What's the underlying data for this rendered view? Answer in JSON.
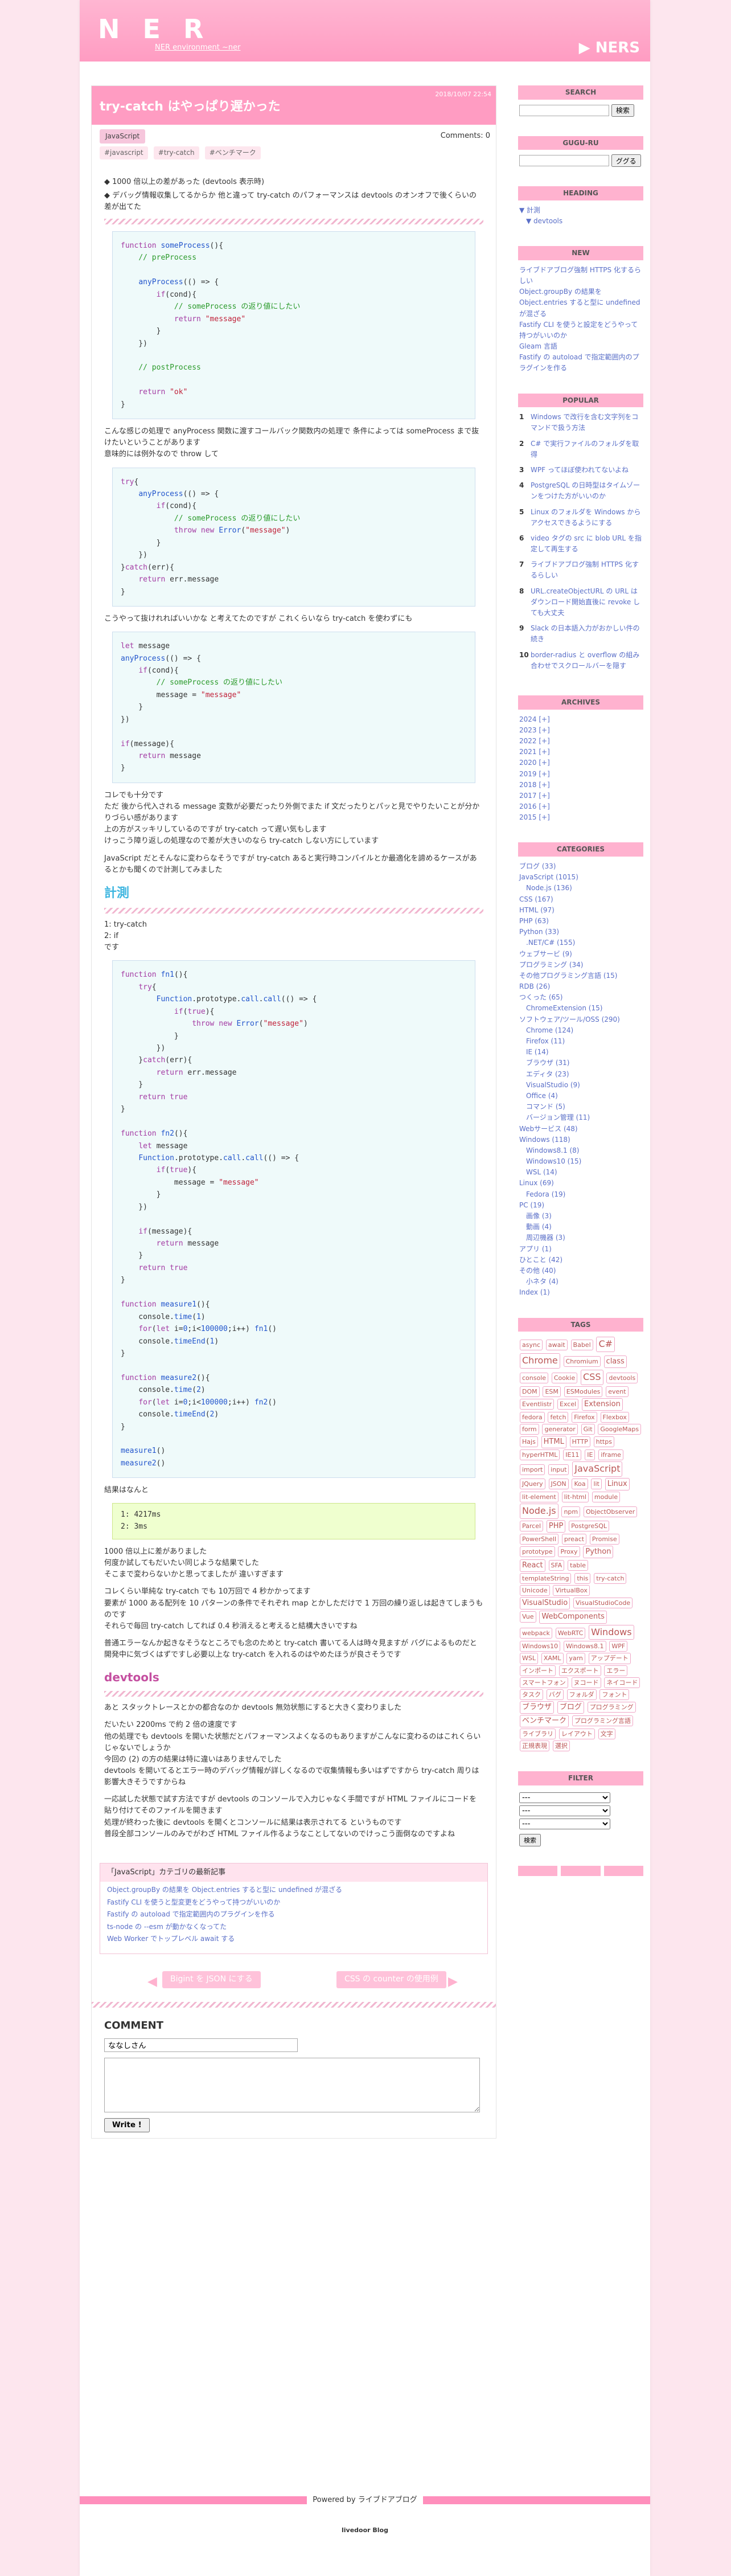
{
  "site": {
    "logo": "N E R",
    "subtitle": "NER environment   ~ner",
    "right": "▶ NERS"
  },
  "article": {
    "title": "try-catch はやっぱり遅かった",
    "date": "2018/10/07 22:54",
    "category": "JavaScript",
    "comments": "Comments: 0",
    "tags": [
      "#javascript",
      "#try-catch",
      "#ベンチマーク"
    ],
    "intro": [
      "◆ 1000 倍以上の差があった (devtools 表示時)",
      "◆ デバッグ情報収集してるからか 他と違って try-catch のパフォーマンスは devtools のオンオフで後くらいの差が出てた"
    ],
    "p1": "こんな感じの処理で anyProcess 関数に渡すコールバック関数内の処理で 条件によっては someProcess まで抜けたいということがあります\n意味的には例外なので throw して",
    "p2": "こうやって抜けれればいいかな と考えてたのですが これくらいなら try-catch を使わずにも",
    "p3": "コレでも十分です\nただ 後から代入される message 変数が必要だったり外側でまた if 文だったりとパッと見でやりたいことが分かりづらい感があります\n上の方がスッキリしているのですが try-catch って遅い気もします\nけっこう障り返しの処理なので差が大きいのなら try-catch しない方にしています",
    "p4": "JavaScript だとそんなに変わらなそうですが try-catch あると実行時コンパイルとか最適化を諦めるケースがあるとかも聞くので計測してみました",
    "measure_title": "計測",
    "measure_list": "1: try-catch\n2: if\nです",
    "result_label": "結果はなんと",
    "result": "1: 4217ms\n2: 3ms",
    "p5": "1000 倍以上に差がありました\n何度か試してもだいたい同じような結果でした\nそこまで変わらないかと思ってましたが 違いすぎます",
    "p6": "コレくらい単純な try-catch でも 10万回で 4 秒かかってます\n要素が 1000 ある配列を 10 パターンの条件でそれぞれ map とかしただけで 1 万回の繰り返しは起きてしまうものです\nそれらで毎回 try-catch してれば 0.4 秒消えると考えると結構大きいですね",
    "p7": "普通エラーなんか起きなそうなところでも念のためと try-catch 書いてる人は時々見ますが バグによるものだと開発中に気づくはずですし必要以上な try-catch を入れるのはやめたほうが良さそうです",
    "devtools_title": "devtools",
    "p8": "あと スタックトレースとかの都合なのか devtools 無効状態にすると大きく変わりました",
    "p9": "だいたい 2200ms で約 2 倍の速度です\n他の処理でも devtools を開いた状態だとパフォーマンスよくなるのもありますがこんなに変わるのはこれくらいじゃないでしょうか\n今回の (2) の方の結果は特に違いはありませんでした\ndevtools を開いてるとエラー時のデバッグ情報が詳しくなるので収集情報も多いはずですから try-catch 周りは影響大きそうですからね",
    "p10": "一応試した状態で試す方法ですが devtools のコンソールで入力じゃなく手間ですが HTML ファイルにコードを貼り付けてそのファイルを開きます\n処理が終わった後に devtools を開くとコンソールに結果は表示されてる というものです\n普段全部コンソールのみでがわざ HTML ファイル作るようなことしてないのでけっこう面倒なのですよね"
  },
  "recent": {
    "heading": "「JavaScript」カテゴリの最新記事",
    "items": [
      "Object.groupBy の結果を Object.entries すると型に undefined が混ざる",
      "Fastify CLI を使うと型変更をどうやって持つがいいのか",
      "Fastify の autoload で指定範囲内のプラグインを作る",
      "ts-node の --esm が動かなくなってた",
      "Web Worker でトップレベル await する"
    ]
  },
  "pager": {
    "prev": "Bigint を JSON にする",
    "next": "CSS の counter の使用例"
  },
  "comment": {
    "heading": "COMMENT",
    "name_value": "ななしさん",
    "submit": "Write !"
  },
  "footer": {
    "powered": "Powered by ライブドアブログ",
    "brand": "livedoor Blog"
  },
  "side": {
    "search": {
      "title": "SEARCH",
      "button": "検索"
    },
    "gugu": {
      "title": "GUGU-RU",
      "button": "ググる"
    },
    "heading": {
      "title": "HEADING",
      "items": [
        "▼ 計測",
        "▼ devtools"
      ]
    },
    "new": {
      "title": "NEW",
      "items": [
        "ライブドアブログ強制 HTTPS 化するらしい",
        "Object.groupBy の結果を Object.entries すると型に undefined が混ざる",
        "Fastify CLI を使うと設定をどうやって持つがいいのか",
        "Gleam 言語",
        "Fastify の autoload で指定範囲内のプラグインを作る"
      ]
    },
    "popular": {
      "title": "POPULAR",
      "items": [
        "Windows で改行を含む文字列をコマンドで扱う方法",
        "C# で実行ファイルのフォルダを取得",
        "WPF ってほぼ使われてないよね",
        "PostgreSQL の日時型はタイムゾーンをつけた方がいいのか",
        "Linux のフォルダを Windows からアクセスできるようにする",
        "video タグの src に blob URL を指定して再生する",
        "ライブドアブログ強制 HTTPS 化するらしい",
        "URL.createObjectURL の URL はダウンロード開始直後に revoke しても大丈夫",
        "Slack の日本語入力がおかしい件の続き",
        "border-radius と overflow の組み合わせでスクロールバーを隠す"
      ]
    },
    "archives": {
      "title": "ARCHIVES",
      "items": [
        "2024 [+]",
        "2023 [+]",
        "2022 [+]",
        "2021 [+]",
        "2020 [+]",
        "2019 [+]",
        "2018 [+]",
        "2017 [+]",
        "2016 [+]",
        "2015 [+]"
      ]
    },
    "categories": {
      "title": "CATEGORIES",
      "items": [
        "ブログ (33)",
        "JavaScript (1015)",
        "　Node.js (136)",
        "CSS (167)",
        "HTML (97)",
        "PHP (63)",
        "Python (33)",
        "　.NET/C# (155)",
        "ウェブサービ (9)",
        "プログラミング (34)",
        "その他プログラミング言語 (15)",
        "RDB (26)",
        "つくった (65)",
        "　ChromeExtension (15)",
        "ソフトウェア/ツール/OSS (290)",
        "　Chrome (124)",
        "　Firefox (11)",
        "　IE (14)",
        "　ブラウザ (31)",
        "　エディタ (23)",
        "　VisualStudio (9)",
        "　Office (4)",
        "　コマンド (5)",
        "　バージョン管理 (11)",
        "Webサービス (48)",
        "Windows (118)",
        "　Windows8.1 (8)",
        "　Windows10 (15)",
        "　WSL (14)",
        "Linux (69)",
        "　Fedora (19)",
        "PC (19)",
        "　画像 (3)",
        "　動画 (4)",
        "　周辺機器 (3)",
        "アプリ (1)",
        "ひとこと (42)",
        "その他 (40)",
        "　小ネタ (4)",
        "Index (1)"
      ]
    },
    "tags": {
      "title": "TAGS",
      "items": [
        "async",
        "await",
        "Babel",
        "C#",
        "Chrome",
        "Chromium",
        "class",
        "console",
        "Cookie",
        "CSS",
        "devtools",
        "DOM",
        "ESM",
        "ESModules",
        "event",
        "Eventlistr",
        "Excel",
        "Extension",
        "fedora",
        "fetch",
        "Firefox",
        "Flexbox",
        "form",
        "generator",
        "Git",
        "GoogleMaps",
        "Hajs",
        "HTML",
        "HTTP",
        "https",
        "hyperHTML",
        "IE11",
        "IE",
        "iframe",
        "import",
        "input",
        "JavaScript",
        "JQuery",
        "JSON",
        "Koa",
        "lit",
        "Linux",
        "lit-element",
        "lit-html",
        "module",
        "Node.js",
        "npm",
        "ObjectObserver",
        "Parcel",
        "PHP",
        "PostgreSQL",
        "PowerShell",
        "preact",
        "Promise",
        "prototype",
        "Proxy",
        "Python",
        "React",
        "SFA",
        "table",
        "templateString",
        "this",
        "try-catch",
        "Unicode",
        "VirtualBox",
        "VisualStudio",
        "VisualStudioCode",
        "Vue",
        "WebComponents",
        "webpack",
        "WebRTC",
        "Windows",
        "Windows10",
        "Windows8.1",
        "WPF",
        "WSL",
        "XAML",
        "yarn",
        "アップデート",
        "インポート",
        "エクスポート",
        "エラー",
        "スマートフォン",
        "ヌコード",
        "ネイコード",
        "タスク",
        "バグ",
        "フォルダ",
        "フォント",
        "ブラウザ",
        "ブログ",
        "プログラミング",
        "ベンチマーク",
        "プログラミング言語",
        "ライブラリ",
        "レイアウト",
        "文字",
        "正規表現",
        "選択"
      ]
    },
    "filter": {
      "title": "FILTER",
      "selects": [
        "",
        "",
        ""
      ],
      "button": "検索"
    }
  }
}
